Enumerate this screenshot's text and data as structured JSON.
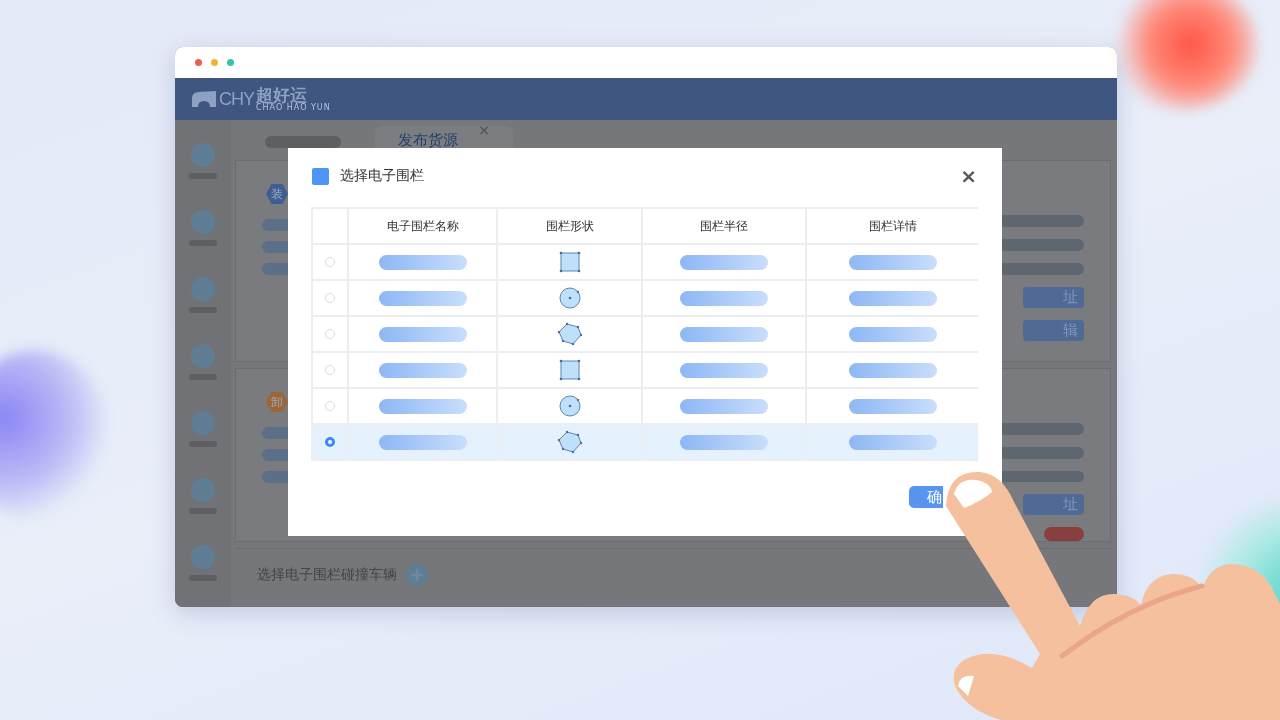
{
  "window": {
    "controls": [
      {
        "color": "#f25a4c"
      },
      {
        "color": "#f5b23a"
      },
      {
        "color": "#2fc6b0"
      }
    ]
  },
  "app": {
    "logo": {
      "mark": "CHY",
      "name": "超好运",
      "subtitle": "CHAO HAO YUN"
    },
    "tab": {
      "label": "发布货源",
      "close": "×"
    },
    "sections": [
      {
        "kind": "loading",
        "badge": "装",
        "buttons": [
          "址",
          "辑"
        ]
      },
      {
        "kind": "unloading",
        "badge": "卸",
        "buttons": [
          "址"
        ]
      }
    ],
    "footer_action": {
      "label": "选择电子围栏碰撞车辆"
    }
  },
  "dialog": {
    "title": "选择电子围栏",
    "close": "×",
    "columns": [
      "电子围栏名称",
      "围栏形状",
      "围栏半径",
      "围栏详情"
    ],
    "rows": [
      {
        "selected": false,
        "kind": "square"
      },
      {
        "selected": false,
        "kind": "circle"
      },
      {
        "selected": false,
        "kind": "pentagon"
      },
      {
        "selected": false,
        "kind": "square"
      },
      {
        "selected": false,
        "kind": "circle"
      },
      {
        "selected": true,
        "kind": "pentagon"
      }
    ],
    "confirm": "确"
  }
}
